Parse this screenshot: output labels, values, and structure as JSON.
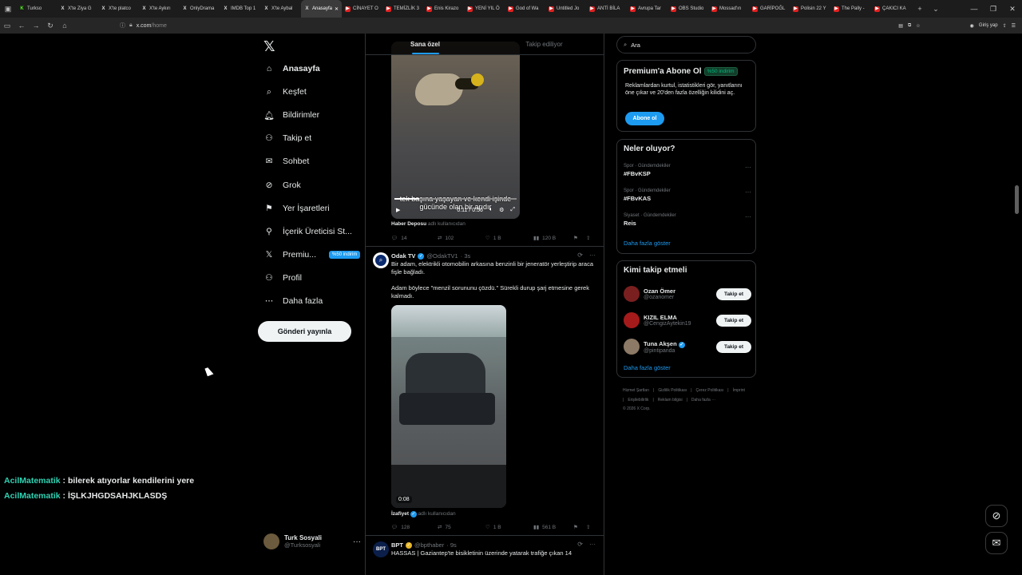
{
  "browser": {
    "tabs": [
      {
        "label": "Turkso",
        "icon": "kick-icon"
      },
      {
        "label": "X'te Ziya G",
        "icon": "x-icon"
      },
      {
        "label": "X'te platco",
        "icon": "x-icon"
      },
      {
        "label": "X'te Aykırı",
        "icon": "x-icon"
      },
      {
        "label": "OnlyDrama",
        "icon": "x-icon"
      },
      {
        "label": "IMDB Top 1",
        "icon": "x-icon"
      },
      {
        "label": "X'te Aybal",
        "icon": "x-icon"
      },
      {
        "label": "Anasayfa",
        "icon": "x-icon",
        "active": true
      },
      {
        "label": "CİNAYET O",
        "icon": "youtube-icon"
      },
      {
        "label": "TEMİZLİK 3",
        "icon": "youtube-icon"
      },
      {
        "label": "Enis Kirazo",
        "icon": "youtube-icon"
      },
      {
        "label": "YENİ YIL Ö",
        "icon": "youtube-icon"
      },
      {
        "label": "God of Wa",
        "icon": "youtube-icon"
      },
      {
        "label": "Untitled Jo",
        "icon": "youtube-icon"
      },
      {
        "label": "ANTİ BİLA",
        "icon": "youtube-icon"
      },
      {
        "label": "Avrupa Tar",
        "icon": "youtube-icon"
      },
      {
        "label": "OBS Studio",
        "icon": "youtube-icon"
      },
      {
        "label": "Mossad'ın",
        "icon": "youtube-icon"
      },
      {
        "label": "GARİPOĞL",
        "icon": "youtube-icon"
      },
      {
        "label": "Polisin 22 Y",
        "icon": "youtube-icon"
      },
      {
        "label": "The Pally -",
        "icon": "youtube-icon"
      },
      {
        "label": "ÇAKICI KA",
        "icon": "youtube-icon"
      }
    ],
    "url_host": "x.com",
    "url_path": "/home",
    "signin_label": "Giriş yap"
  },
  "nav": {
    "items": [
      {
        "label": "Anasayfa",
        "icon": "home-icon",
        "bold": true
      },
      {
        "label": "Keşfet",
        "icon": "search-icon"
      },
      {
        "label": "Bildirimler",
        "icon": "bell-icon"
      },
      {
        "label": "Takip et",
        "icon": "add-person-icon"
      },
      {
        "label": "Sohbet",
        "icon": "mail-icon"
      },
      {
        "label": "Grok",
        "icon": "grok-icon"
      },
      {
        "label": "Yer İşaretleri",
        "icon": "bookmark-icon"
      },
      {
        "label": "İçerik Üreticisi St...",
        "icon": "creator-icon"
      },
      {
        "label": "Premiu...",
        "icon": "x-logo-icon",
        "badge": "%50 indirim"
      },
      {
        "label": "Profil",
        "icon": "person-icon"
      },
      {
        "label": "Daha fazla",
        "icon": "more-circle-icon"
      }
    ],
    "post_button": "Gönderi yayınla",
    "account": {
      "name": "Turk Sosyali",
      "handle": "@Turksosyali"
    }
  },
  "feed": {
    "tabs": [
      {
        "label": "Sana özel",
        "active": true
      },
      {
        "label": "Takip ediliyor"
      }
    ],
    "video1": {
      "caption": "tek başına yaşayan ve kendi işinde gücünde olan bir arıdır",
      "time": "0:11 / 0:56",
      "progress": 0.2,
      "source_name": "Haber Deposu",
      "source_suffix": "adlı kullanıcıdan"
    },
    "post1_stats": {
      "replies": "14",
      "reposts": "102",
      "likes": "1 B",
      "views": "120 B"
    },
    "tweet2": {
      "name": "Odak TV",
      "handle": "@OdakTV1",
      "time": "· 3s",
      "text1": "Bir adam, elektrikli otomobilin arkasına benzinli bir jeneratör yerleştirip araca fişle bağladı.",
      "text2": "Adam böylece \"menzil sorununu çözdü.\" Sürekli durup şarj etmesine gerek kalmadı.",
      "video_time": "0:08",
      "source_name": "İzafiyet",
      "source_suffix": "adlı kullanıcıdan",
      "stats": {
        "replies": "128",
        "reposts": "75",
        "likes": "1 B",
        "views": "561 B"
      }
    },
    "tweet3": {
      "name": "BPT",
      "handle": "@bpthaber",
      "time": "· 9s",
      "text": "HASSAS | Gaziantep'te bisikletinin üzerinde yatarak trafiğe çıkan 14",
      "avatar_text": "BPT"
    }
  },
  "sidebar": {
    "search_placeholder": "Ara",
    "premium": {
      "title": "Premium'a Abone Ol",
      "badge": "%50 indirim",
      "desc": "Reklamlardan kurtul, istatistikleri gör, yanıtlarını öne çıkar ve 20'den fazla özelliğin kilidini aç.",
      "button": "Abone ol"
    },
    "trends": {
      "title": "Neler oluyor?",
      "items": [
        {
          "meta": "Spor · Gündemdekiler",
          "name": "#FBvKSP"
        },
        {
          "meta": "Spor · Gündemdekiler",
          "name": "#FBvKAS"
        },
        {
          "meta": "Siyaset · Gündemdekiler",
          "name": "Reis"
        }
      ],
      "show_more": "Daha fazla göster"
    },
    "who_to_follow": {
      "title": "Kimi takip etmeli",
      "items": [
        {
          "name": "Ozan Ömer",
          "handle": "@ozanomer",
          "button": "Takip et",
          "color": "#7a1f1f"
        },
        {
          "name": "KIZIL ELMA",
          "handle": "@CengizAytekin19",
          "button": "Takip et",
          "color": "#a51b1b"
        },
        {
          "name": "Tuna Akşen",
          "handle": "@pintipanda",
          "button": "Takip et",
          "color": "#8c7a66",
          "verified": true
        }
      ],
      "show_more": "Daha fazla göster"
    },
    "footer": [
      "Hizmet Şartları",
      "|",
      "Gizlilik Politikası",
      "|",
      "Çerez Politikası",
      "|",
      "İmprint",
      "|",
      "Erişilebilirlik",
      "|",
      "Reklam bilgisi",
      "|",
      "Daha fazla ···",
      "© 2026 X Corp."
    ]
  },
  "chat": [
    {
      "user": "AcilMatematik",
      "text": " : bilerek atıyorlar kendilerini yere"
    },
    {
      "user": "AcilMatematik",
      "text": " : İŞLKJHGDSAHJKLASDŞ"
    }
  ],
  "colors": {
    "accent": "#1d9bf0",
    "chat_user": "#2fd3b4",
    "promo_green": "#00ba7c"
  }
}
